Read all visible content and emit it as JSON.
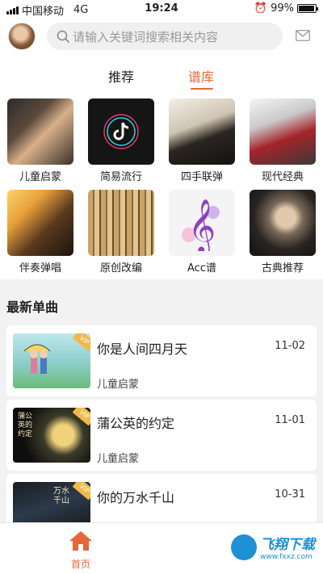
{
  "status": {
    "carrier": "中国移动",
    "network": "4G",
    "time": "19:24",
    "battery": "99%",
    "battery_level": 0.99
  },
  "header": {
    "search_placeholder": "请输入关键词搜索相关内容"
  },
  "tabs": [
    {
      "label": "推荐",
      "active": false
    },
    {
      "label": "谱库",
      "active": true
    }
  ],
  "categories": [
    {
      "label": "儿童启蒙"
    },
    {
      "label": "简易流行"
    },
    {
      "label": "四手联弹"
    },
    {
      "label": "现代经典"
    },
    {
      "label": "伴奏弹唱"
    },
    {
      "label": "原创改编"
    },
    {
      "label": "Acc谱"
    },
    {
      "label": "古典推荐"
    }
  ],
  "section": {
    "title": "最新单曲"
  },
  "songs": [
    {
      "title": "你是人间四月天",
      "date": "11-02",
      "tag": "儿童启蒙",
      "badge": "VIP"
    },
    {
      "title": "蒲公英的约定",
      "date": "11-01",
      "tag": "儿童启蒙",
      "badge": "VIP",
      "cover_text": "蒲公英的约定"
    },
    {
      "title": "你的万水千山",
      "date": "10-31",
      "tag": "",
      "badge": "VIP",
      "cover_text": "万水千山"
    }
  ],
  "nav": {
    "home_label": "首页"
  },
  "watermark": {
    "text": "飞翔下载",
    "sub": "www.fxxz.com"
  },
  "colors": {
    "accent": "#e5673a",
    "vip": "#f1b94c"
  }
}
